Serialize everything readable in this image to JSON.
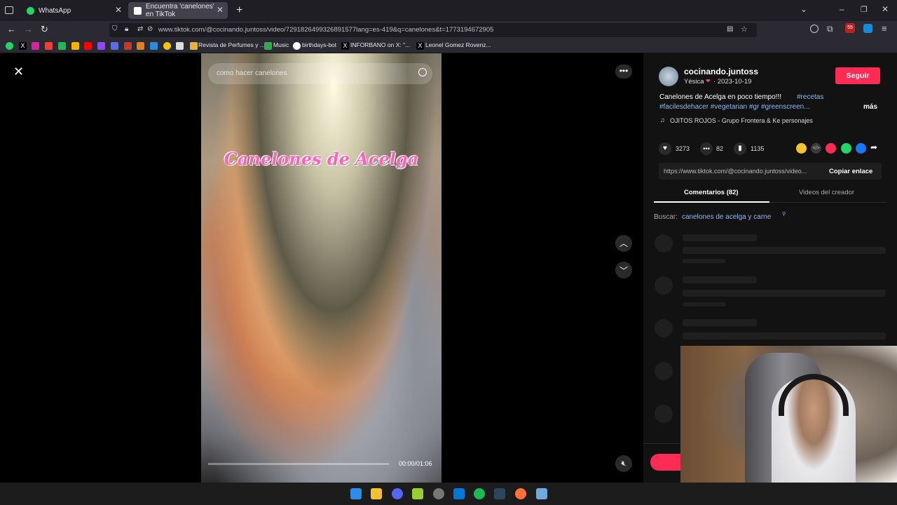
{
  "browser": {
    "tabs": [
      {
        "label": "WhatsApp",
        "active": false
      },
      {
        "label": "Encuentra 'canelones' en TikTok",
        "active": true
      }
    ],
    "url": "www.tiktok.com/@cocinando.juntoss/video/7291826499326891577lang=es-419&q=canelones&t=1773194672905",
    "bookmarks": [
      "Revista de Perfumes y ...",
      "Music",
      "birthdays-bot",
      "INFORBANO on X: \"...",
      "Leonel Gomez Rovenz..."
    ],
    "notification_count": "55"
  },
  "video": {
    "search_placeholder": "como hacer canelones",
    "overlay_title": "Canelones de Acelga",
    "timecode": "00:00/01:06",
    "progress": 0
  },
  "creator": {
    "username": "cocinando.juntoss",
    "display_name": "Yésica",
    "date": "· 2023-10-19",
    "follow_label": "Seguir"
  },
  "post": {
    "caption_line1": "Canelones de Acelga en poco tiempo!!! ",
    "hashtag1": "#recetas",
    "caption_line2": "#facilesdehacer #vegetarian #gr #greenscreen...",
    "more_label": "más",
    "music": "OJITOS ROJOS - Grupo Frontera & Ke personajes"
  },
  "stats": {
    "likes": "3273",
    "comments": "82",
    "saves": "1135"
  },
  "share": {
    "link": "https://www.tiktok.com/@cocinando.juntoss/video...",
    "copy_label": "Copiar enlace"
  },
  "tabs": {
    "comments": "Comentarios (82)",
    "creator_videos": "Videos del creador"
  },
  "search_suggest": {
    "prefix": "Buscar:",
    "query": "canelones de acelga y carne"
  },
  "colors": {
    "accent": "#fe2c55",
    "link": "#8fb8f0",
    "panel_bg": "#121212"
  }
}
